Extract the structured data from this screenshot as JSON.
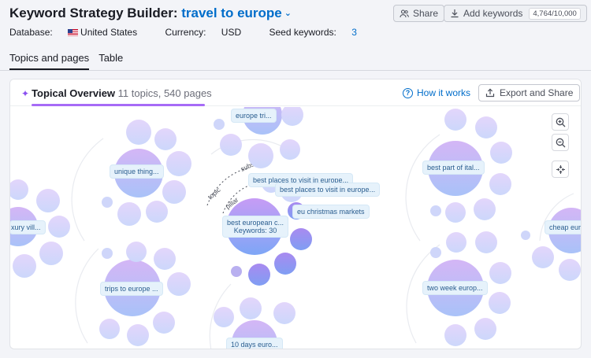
{
  "header": {
    "title_prefix": "Keyword Strategy Builder: ",
    "title_keyword": "travel to europe",
    "share_label": "Share",
    "add_keywords_label": "Add keywords",
    "keyword_counter": "4,764/10,000"
  },
  "meta": {
    "database_label": "Database:",
    "database_value": "United States",
    "currency_label": "Currency:",
    "currency_value": "USD",
    "seed_label": "Seed keywords:",
    "seed_value": "3"
  },
  "tabs": [
    {
      "label": "Topics and pages",
      "active": true
    },
    {
      "label": "Table",
      "active": false
    }
  ],
  "overview": {
    "title": "Topical Overview",
    "subtitle": "11 topics, 540 pages",
    "how_it_works": "How it works",
    "export_label": "Export and Share"
  },
  "graph": {
    "arc_labels": {
      "subs": "subs",
      "topic": "topic",
      "pillar": "pillar"
    },
    "topics": [
      {
        "label": "europe tri..."
      },
      {
        "label": "unique thing..."
      },
      {
        "label": "xury vill..."
      },
      {
        "label": "trips to europe ..."
      },
      {
        "label": "best european c...",
        "keywords": "Keywords: 30"
      },
      {
        "label": "10 days euro..."
      },
      {
        "label": "best part of ital..."
      },
      {
        "label": "two week europ..."
      },
      {
        "label": "cheap eur"
      }
    ],
    "subtopics": [
      {
        "label": "best places to visit in europe..."
      },
      {
        "label": "best places to visit in europe..."
      },
      {
        "label": "eu christmas markets"
      }
    ]
  },
  "colors": {
    "accent": "#a66bf6",
    "link": "#006dca",
    "bubble_light": "#d8dcfb",
    "bubble_pillar_top": "#c79cf5",
    "bubble_pillar_bottom": "#7ea6f6"
  }
}
